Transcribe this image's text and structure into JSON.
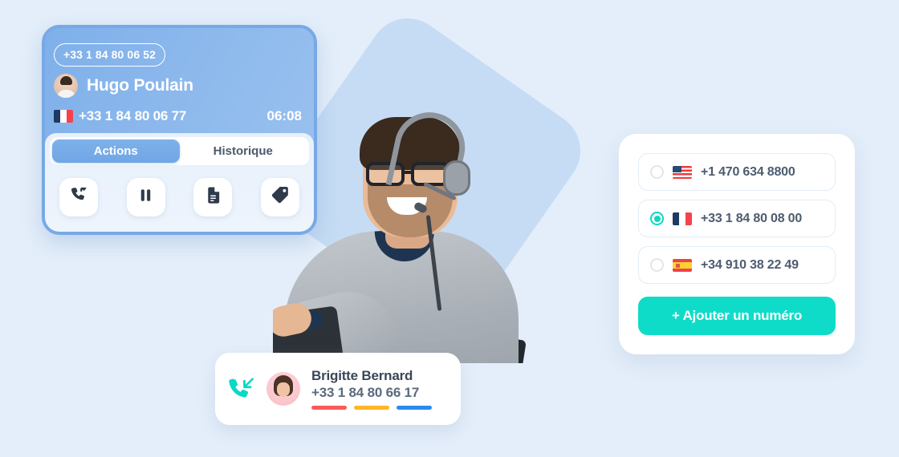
{
  "theme": {
    "page_background": "#e4eefa",
    "deco_shape": "#c6dcf4",
    "accent_teal": "#0fdcc8",
    "card_blue": "#8cb8ec",
    "text_dark": "#3b4757"
  },
  "call_card": {
    "badge_number": "+33 1 84 80 06 52",
    "caller_name": "Hugo Poulain",
    "caller_flag": "flag-france",
    "caller_number": "+33 1 84 80 06 77",
    "timer": "06:08",
    "tabs": [
      {
        "label": "Actions",
        "active": true
      },
      {
        "label": "Historique",
        "active": false
      }
    ],
    "actions": [
      {
        "icon": "call-transfer-icon",
        "name": "transfer-call-button"
      },
      {
        "icon": "pause-icon",
        "name": "pause-call-button"
      },
      {
        "icon": "document-icon",
        "name": "notes-button"
      },
      {
        "icon": "tag-icon",
        "name": "tag-call-button"
      }
    ]
  },
  "contact_card": {
    "call_direction_icon": "incoming-call-icon",
    "avatar": "avatar-brigitte",
    "name": "Brigitte Bernard",
    "number": "+33 1 84 80 66 17",
    "bars": [
      {
        "color": "#fa5a5a"
      },
      {
        "color": "#ffb629"
      },
      {
        "color": "#2b8aee"
      }
    ]
  },
  "numbers_panel": {
    "rows": [
      {
        "flag": "flag-usa",
        "number": "+1 470 634 8800",
        "selected": false
      },
      {
        "flag": "flag-france",
        "number": "+33 1 84 80 08 00",
        "selected": true
      },
      {
        "flag": "flag-spain",
        "number": "+34 910 38 22 49",
        "selected": false
      }
    ],
    "add_button_label": "+ Ajouter un numéro"
  }
}
